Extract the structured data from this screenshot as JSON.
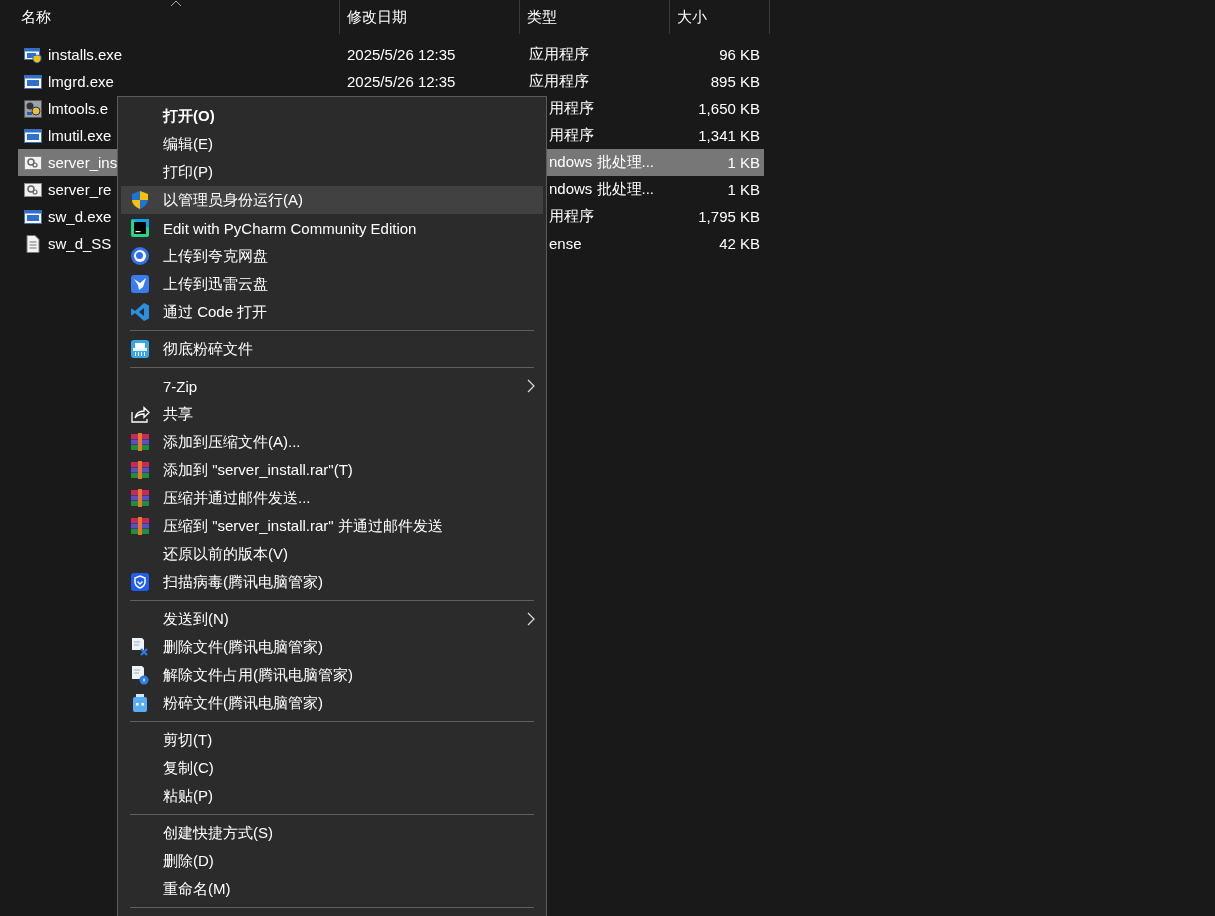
{
  "columns": [
    {
      "label": "名称",
      "sorted": true
    },
    {
      "label": "修改日期",
      "sorted": false
    },
    {
      "label": "类型",
      "sorted": false
    },
    {
      "label": "大小",
      "sorted": false
    }
  ],
  "files": [
    {
      "name": "installs.exe",
      "date": "2025/5/26 12:35",
      "type": "应用程序",
      "size": "96 KB",
      "selected": false,
      "type_cut": false
    },
    {
      "name": "lmgrd.exe",
      "date": "2025/5/26 12:35",
      "type": "应用程序",
      "size": "895 KB",
      "selected": false,
      "type_cut": false
    },
    {
      "name": "lmtools.e",
      "type": "用程序",
      "size": "1,650 KB",
      "selected": false,
      "type_cut": true
    },
    {
      "name": "lmutil.exe",
      "type": "用程序",
      "size": "1,341 KB",
      "selected": false,
      "type_cut": true
    },
    {
      "name": "server_ins",
      "type": "ndows 批处理...",
      "size": "1 KB",
      "selected": true,
      "type_cut": true
    },
    {
      "name": "server_re",
      "type": "ndows 批处理...",
      "size": "1 KB",
      "selected": false,
      "type_cut": true
    },
    {
      "name": "sw_d.exe",
      "type": "用程序",
      "size": "1,795 KB",
      "selected": false,
      "type_cut": true
    },
    {
      "name": "sw_d_SS",
      "type": "ense",
      "size": "42 KB",
      "selected": false,
      "type_cut": true
    }
  ],
  "context_menu": [
    {
      "kind": "item",
      "label": "打开(O)",
      "bold": true,
      "highlighted": false,
      "submenu": false
    },
    {
      "kind": "item",
      "label": "编辑(E)",
      "bold": false,
      "highlighted": false,
      "submenu": false
    },
    {
      "kind": "item",
      "label": "打印(P)",
      "bold": false,
      "highlighted": false,
      "submenu": false
    },
    {
      "kind": "item",
      "label": "以管理员身份运行(A)",
      "bold": false,
      "highlighted": true,
      "submenu": false
    },
    {
      "kind": "item",
      "label": "Edit with PyCharm Community Edition",
      "bold": false,
      "highlighted": false,
      "submenu": false
    },
    {
      "kind": "item",
      "label": "上传到夸克网盘",
      "bold": false,
      "highlighted": false,
      "submenu": false
    },
    {
      "kind": "item",
      "label": "上传到迅雷云盘",
      "bold": false,
      "highlighted": false,
      "submenu": false
    },
    {
      "kind": "item",
      "label": "通过 Code 打开",
      "bold": false,
      "highlighted": false,
      "submenu": false
    },
    {
      "kind": "separator"
    },
    {
      "kind": "item",
      "label": "彻底粉碎文件",
      "bold": false,
      "highlighted": false,
      "submenu": false
    },
    {
      "kind": "separator"
    },
    {
      "kind": "item",
      "label": "7-Zip",
      "bold": false,
      "highlighted": false,
      "submenu": true
    },
    {
      "kind": "item",
      "label": "共享",
      "bold": false,
      "highlighted": false,
      "submenu": false
    },
    {
      "kind": "item",
      "label": "添加到压缩文件(A)...",
      "bold": false,
      "highlighted": false,
      "submenu": false
    },
    {
      "kind": "item",
      "label": "添加到 \"server_install.rar\"(T)",
      "bold": false,
      "highlighted": false,
      "submenu": false
    },
    {
      "kind": "item",
      "label": "压缩并通过邮件发送...",
      "bold": false,
      "highlighted": false,
      "submenu": false
    },
    {
      "kind": "item",
      "label": "压缩到 \"server_install.rar\" 并通过邮件发送",
      "bold": false,
      "highlighted": false,
      "submenu": false
    },
    {
      "kind": "item",
      "label": "还原以前的版本(V)",
      "bold": false,
      "highlighted": false,
      "submenu": false
    },
    {
      "kind": "item",
      "label": "扫描病毒(腾讯电脑管家)",
      "bold": false,
      "highlighted": false,
      "submenu": false
    },
    {
      "kind": "separator"
    },
    {
      "kind": "item",
      "label": "发送到(N)",
      "bold": false,
      "highlighted": false,
      "submenu": true
    },
    {
      "kind": "item",
      "label": "删除文件(腾讯电脑管家)",
      "bold": false,
      "highlighted": false,
      "submenu": false
    },
    {
      "kind": "item",
      "label": "解除文件占用(腾讯电脑管家)",
      "bold": false,
      "highlighted": false,
      "submenu": false
    },
    {
      "kind": "item",
      "label": "粉碎文件(腾讯电脑管家)",
      "bold": false,
      "highlighted": false,
      "submenu": false
    },
    {
      "kind": "separator"
    },
    {
      "kind": "item",
      "label": "剪切(T)",
      "bold": false,
      "highlighted": false,
      "submenu": false
    },
    {
      "kind": "item",
      "label": "复制(C)",
      "bold": false,
      "highlighted": false,
      "submenu": false
    },
    {
      "kind": "item",
      "label": "粘贴(P)",
      "bold": false,
      "highlighted": false,
      "submenu": false
    },
    {
      "kind": "separator"
    },
    {
      "kind": "item",
      "label": "创建快捷方式(S)",
      "bold": false,
      "highlighted": false,
      "submenu": false
    },
    {
      "kind": "item",
      "label": "删除(D)",
      "bold": false,
      "highlighted": false,
      "submenu": false
    },
    {
      "kind": "item",
      "label": "重命名(M)",
      "bold": false,
      "highlighted": false,
      "submenu": false
    },
    {
      "kind": "separator"
    }
  ]
}
